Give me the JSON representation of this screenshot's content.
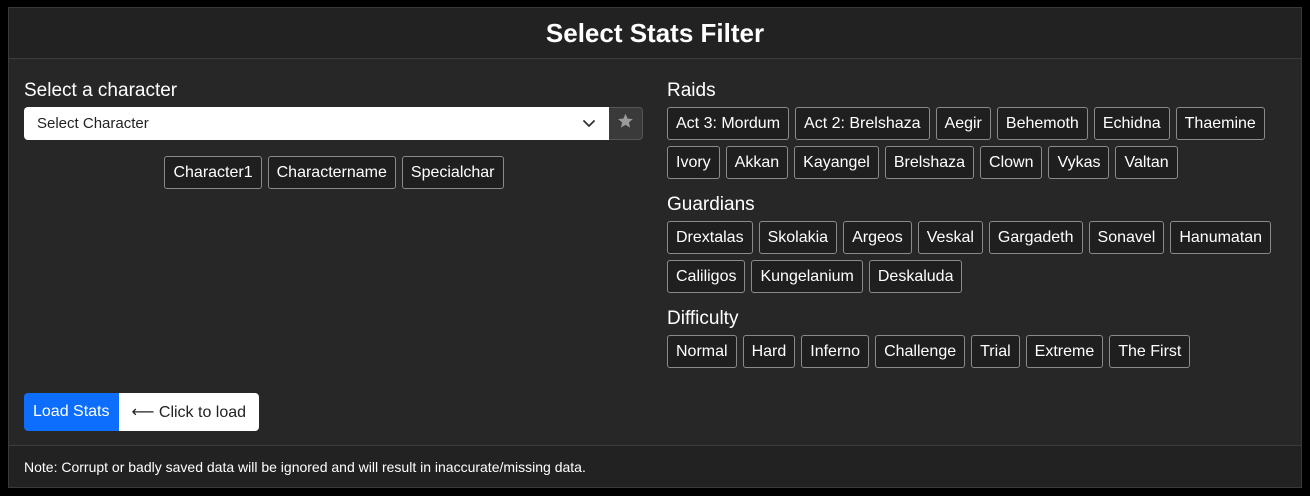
{
  "header": {
    "title": "Select Stats Filter"
  },
  "character": {
    "label": "Select a character",
    "select_value": "Select Character",
    "chips": [
      "Character1",
      "Charactername",
      "Specialchar"
    ]
  },
  "raids": {
    "label": "Raids",
    "items": [
      "Act 3: Mordum",
      "Act 2: Brelshaza",
      "Aegir",
      "Behemoth",
      "Echidna",
      "Thaemine",
      "Ivory",
      "Akkan",
      "Kayangel",
      "Brelshaza",
      "Clown",
      "Vykas",
      "Valtan"
    ]
  },
  "guardians": {
    "label": "Guardians",
    "items": [
      "Drextalas",
      "Skolakia",
      "Argeos",
      "Veskal",
      "Gargadeth",
      "Sonavel",
      "Hanumatan",
      "Caliligos",
      "Kungelanium",
      "Deskaluda"
    ]
  },
  "difficulty": {
    "label": "Difficulty",
    "items": [
      "Normal",
      "Hard",
      "Inferno",
      "Challenge",
      "Trial",
      "Extreme",
      "The First"
    ]
  },
  "load": {
    "button_label": "Load Stats",
    "hint": "⟵ Click to load"
  },
  "footer": {
    "note": "Note: Corrupt or badly saved data will be ignored and will result in inaccurate/missing data."
  },
  "colors": {
    "background": "#272727",
    "primary": "#0d6efd",
    "chip_border": "#8a8a8a"
  },
  "icons": {
    "select": "chevron-down-icon",
    "favorite": "star-icon"
  }
}
